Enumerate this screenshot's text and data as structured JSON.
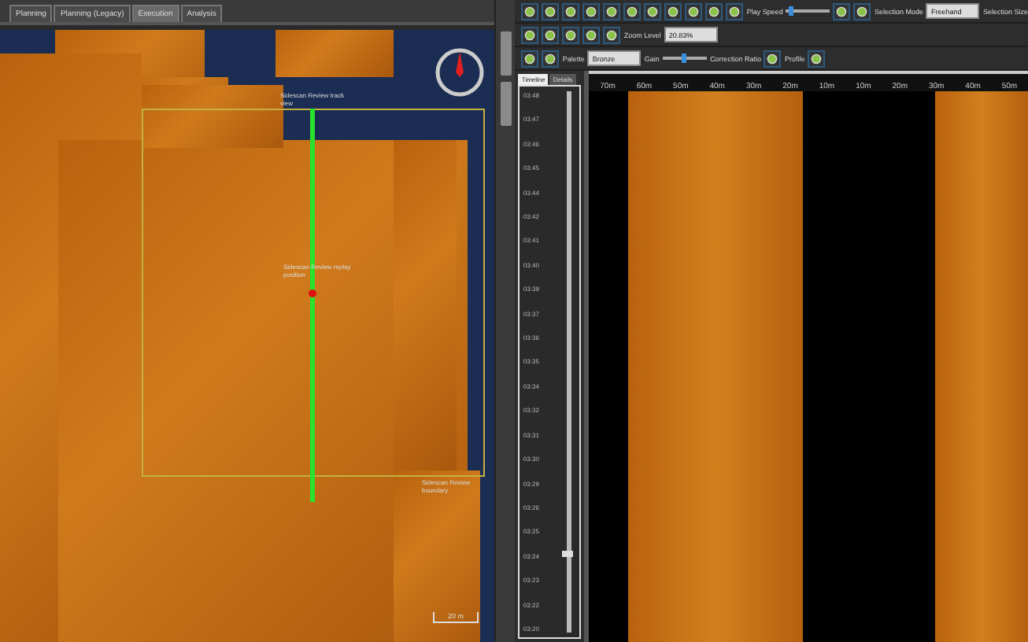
{
  "tabs": [
    {
      "label": "Planning",
      "selected": false
    },
    {
      "label": "Planning (Legacy)",
      "selected": false
    },
    {
      "label": "Execution",
      "selected": true
    },
    {
      "label": "Analysis",
      "selected": false
    }
  ],
  "map": {
    "labels": [
      {
        "text": "Sidescan Review track view",
        "kind": "track"
      },
      {
        "text": "Sidescan Review replay position",
        "kind": "position"
      },
      {
        "text": "Sidescan Review boundary",
        "kind": "boundary"
      }
    ],
    "scale": "20 m"
  },
  "toolbar": {
    "play_speed_label": "Play Speed",
    "play_speed": {
      "level": 0.05
    },
    "selection_mode_label": "Selection Mode",
    "selection_mode": "Freehand",
    "selection_size_label": "Selection Size",
    "zoom_label": "Zoom Level",
    "zoom_value": "20.83%",
    "palette_label": "Palette",
    "palette": "Bronze",
    "gain_label": "Gain",
    "gain": {
      "level": 0.5
    },
    "correction_label": "Correction Ratio",
    "profile_label": "Profile"
  },
  "ruler": [
    "70m",
    "60m",
    "50m",
    "40m",
    "30m",
    "20m",
    "10m",
    "10m",
    "20m",
    "30m",
    "40m",
    "50m"
  ],
  "timeline": {
    "tabs": [
      {
        "label": "Timeline",
        "selected": true
      },
      {
        "label": "Details",
        "selected": false
      }
    ],
    "times": [
      "03:48",
      "03:47",
      "03:46",
      "03:45",
      "03:44",
      "03:42",
      "03:41",
      "03:40",
      "03:39",
      "03:37",
      "03:36",
      "03:35",
      "03:34",
      "03:32",
      "03:31",
      "03:30",
      "03:29",
      "03:26",
      "03:25",
      "03:24",
      "03:23",
      "03:22",
      "03:20"
    ],
    "level": 0.14
  }
}
